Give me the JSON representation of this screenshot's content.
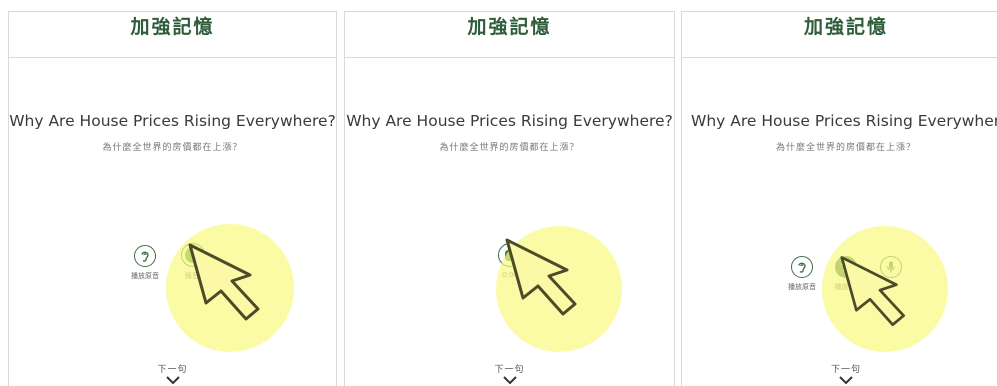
{
  "colors": {
    "accent": "#3f6f47",
    "highlight": "#f7f36f"
  },
  "panels": [
    {
      "header": "加強記憶",
      "title": "Why Are House Prices Rising Everywhere?",
      "subtitle": "為什麼全世界的房價都在上漲？",
      "buttons": [
        {
          "icon": "ear-icon",
          "label": "播放原音"
        },
        {
          "icon": "record-icon",
          "label": "錄音"
        }
      ],
      "next_label": "下一句"
    },
    {
      "header": "加強記憶",
      "title": "Why Are House Prices Rising Everywhere?",
      "subtitle": "為什麼全世界的房價都在上漲？",
      "buttons": [
        {
          "icon": "stop-icon",
          "label": "0:00"
        }
      ],
      "next_label": "下一句"
    },
    {
      "header": "加強記憶",
      "title": "Why Are House Prices Rising Everywhere?",
      "subtitle": "為什麼全世界的房價都在上漲？",
      "buttons": [
        {
          "icon": "ear-icon",
          "label": "播放原音"
        },
        {
          "icon": "play-recording-icon",
          "label": "播放錄"
        },
        {
          "icon": "microphone-icon",
          "label": ""
        }
      ],
      "next_label": "下一句"
    }
  ]
}
